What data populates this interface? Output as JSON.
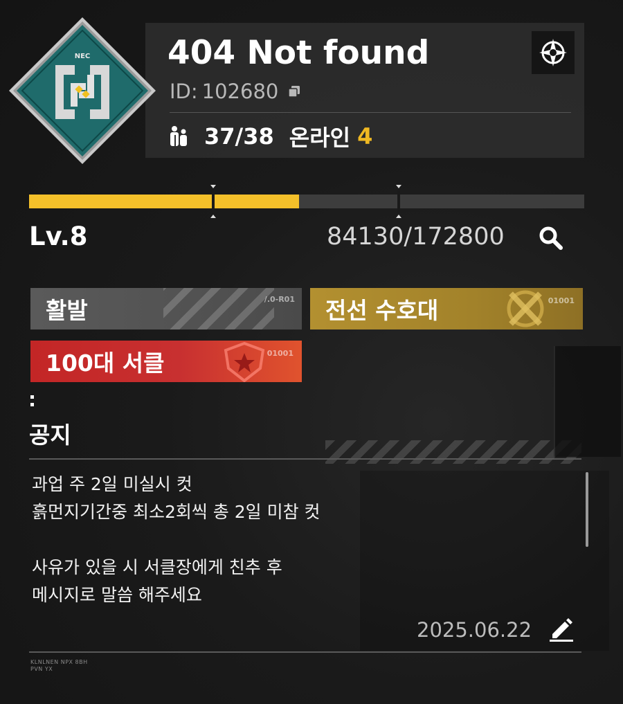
{
  "circle": {
    "name": "404 Not found",
    "id_label": "ID:",
    "id_value": "102680",
    "members": "37/38",
    "online_label": "온라인",
    "online_count": "4",
    "emblem_text": "NEC"
  },
  "level": {
    "label": "Lv.8",
    "exp": "84130/172800",
    "progress_fraction": 0.4869
  },
  "tags": [
    {
      "label": "활발",
      "code": "/.0-R01"
    },
    {
      "label": "전선 수호대",
      "code": "01001"
    },
    {
      "label": "100대 서클",
      "code": "01001"
    }
  ],
  "notice": {
    "title": "공지",
    "body": " 과업 주 2일 미실시 컷\n흙먼지기간중 최소2회씩 총 2일 미참 컷\n\n사유가 있을 시 서클장에게 친추 후\n메시지로 말씀 해주세요",
    "date": "2025.06.22"
  },
  "footer_code": "KLNLNEN NPX 8BH\nPVN YX",
  "colors": {
    "accent_yellow": "#f4c02a",
    "online_yellow": "#f0b922",
    "tag_gold": "#b39030",
    "tag_red": "#c83030",
    "emblem_teal": "#1f6b6b"
  },
  "icons": {
    "emblem": "circle-emblem-icon",
    "copy": "copy-icon",
    "members": "members-icon",
    "compass": "compass-icon",
    "search": "search-icon",
    "crossed_swords": "crossed-swords-icon",
    "star_shield": "star-shield-icon",
    "edit": "pencil-edit-icon"
  }
}
